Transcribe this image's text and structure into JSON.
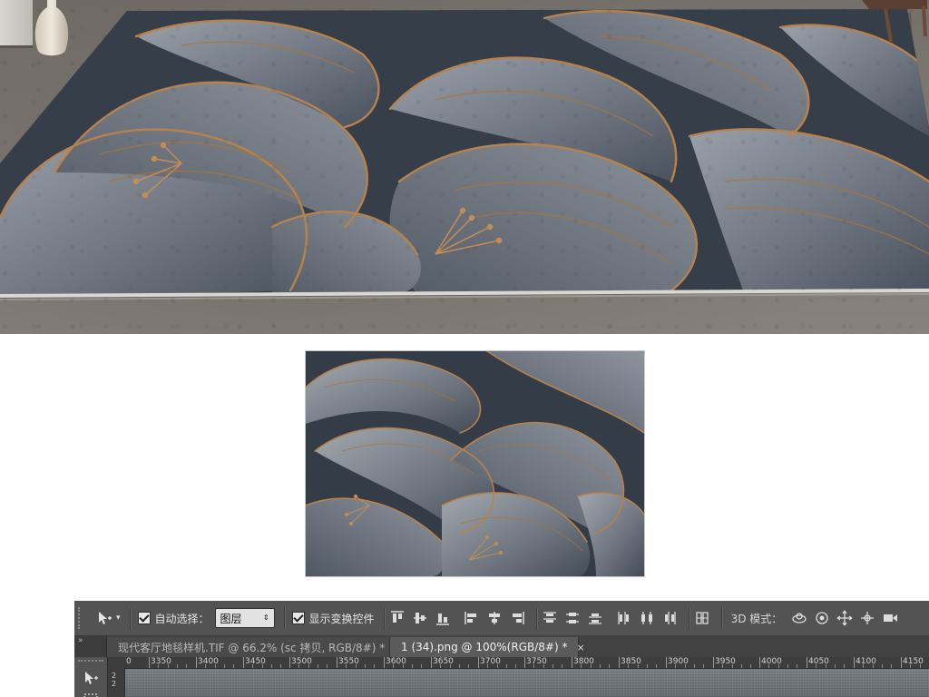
{
  "photoshop": {
    "options_bar": {
      "auto_select_label": "自动选择：",
      "auto_select_checked": true,
      "layer_dropdown_value": "图层",
      "show_transform_label": "显示变换控件",
      "show_transform_checked": true,
      "mode_3d_label": "3D 模式："
    },
    "tabs": [
      {
        "label": "现代客厅地毯样机.TIF @ 66.2% (sc 拷贝, RGB/8#) *",
        "close": "×",
        "active": false
      },
      {
        "label": "1 (34).png @ 100%(RGB/8#) *",
        "close": "×",
        "active": true
      }
    ],
    "toolcol_head": "»",
    "ruler": {
      "h_ticks": [
        "3350",
        "3400",
        "3450",
        "3500",
        "3550",
        "3600",
        "3650",
        "3700",
        "3750",
        "3800",
        "3850",
        "3900",
        "3950",
        "4000",
        "4050",
        "4100",
        "4150"
      ],
      "h_first_label": "0",
      "v_ticks": [
        "2",
        "2"
      ]
    }
  },
  "icons": {
    "move_tool": "move-tool-icon",
    "align": [
      "align-top-edges-icon",
      "align-vertical-centers-icon",
      "align-bottom-edges-icon",
      "align-left-edges-icon",
      "align-horizontal-centers-icon",
      "align-right-edges-icon"
    ],
    "distribute": [
      "distribute-top-icon",
      "distribute-vertical-centers-icon",
      "distribute-bottom-icon",
      "distribute-left-icon",
      "distribute-horizontal-centers-icon",
      "distribute-right-icon"
    ],
    "auto_align": "auto-align-layers-icon",
    "mode_3d": [
      "rotate-3d-icon",
      "roll-3d-icon",
      "drag-3d-icon",
      "slide-3d-icon",
      "scale-3d-icon"
    ]
  },
  "colors": {
    "rug_base": "#3c4450",
    "rug_petal": "#7d8490",
    "rug_gold": "#b07a45",
    "floor": "#7c7770",
    "ps_panel": "#535353",
    "ps_tabbar": "#424242",
    "ps_ruler": "#3d3d3d"
  }
}
